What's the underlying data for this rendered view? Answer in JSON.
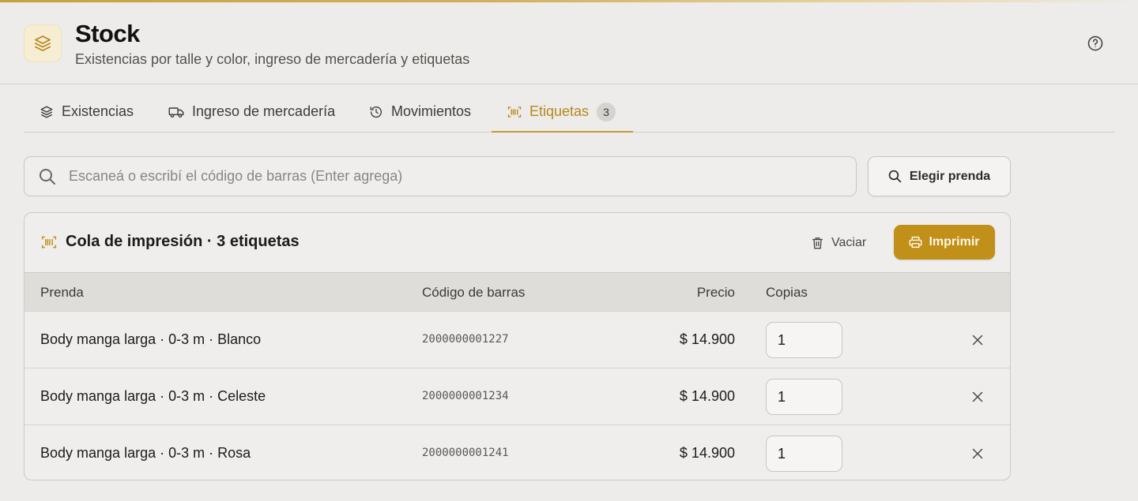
{
  "header": {
    "title": "Stock",
    "subtitle": "Existencias por talle y color, ingreso de mercadería y etiquetas",
    "icon": "layers-icon",
    "help_icon": "help-circle-icon"
  },
  "tabs": [
    {
      "label": "Existencias",
      "icon": "layers-icon",
      "active": false
    },
    {
      "label": "Ingreso de mercadería",
      "icon": "truck-icon",
      "active": false
    },
    {
      "label": "Movimientos",
      "icon": "history-icon",
      "active": false
    },
    {
      "label": "Etiquetas",
      "icon": "barcode-icon",
      "active": true,
      "badge": "3"
    }
  ],
  "search": {
    "placeholder": "Escaneá o escribí el código de barras (Enter agrega)",
    "value": ""
  },
  "pick_button": {
    "label": "Elegir prenda"
  },
  "queue": {
    "title": "Cola de impresión · 3 etiquetas",
    "clear_label": "Vaciar",
    "print_label": "Imprimir",
    "columns": [
      "Prenda",
      "Código de barras",
      "Precio",
      "Copias"
    ],
    "rows": [
      {
        "name": "Body manga larga · 0-3 m · Blanco",
        "barcode": "2000000001227",
        "price": "$ 14.900",
        "copies": "1"
      },
      {
        "name": "Body manga larga · 0-3 m · Celeste",
        "barcode": "2000000001234",
        "price": "$ 14.900",
        "copies": "1"
      },
      {
        "name": "Body manga larga · 0-3 m · Rosa",
        "barcode": "2000000001241",
        "price": "$ 14.900",
        "copies": "1"
      }
    ]
  },
  "colors": {
    "accent": "#c09018",
    "accent_text": "#b5881c",
    "background": "#edecea"
  }
}
